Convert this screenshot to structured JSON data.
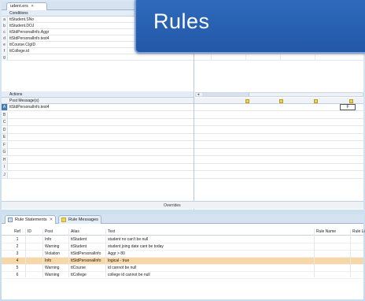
{
  "editor": {
    "tab_label": "udent.ers",
    "tab_close": "✕"
  },
  "conditions": {
    "header": "Conditions",
    "rows": [
      {
        "key": "a",
        "label": "ttStudent.SNo",
        "cells": []
      },
      {
        "key": "b",
        "label": "ttStudent.DOJ",
        "cells": []
      },
      {
        "key": "c",
        "label": "ttStdPersonalInfo.Aggr",
        "cells": []
      },
      {
        "key": "d",
        "label": "ttStdPersonalInfo.test4",
        "cells": [
          "-",
          "-",
          "-",
          "-"
        ]
      },
      {
        "key": "e",
        "label": "ttCourse.CIgID",
        "cells": [
          "-",
          "-",
          "-",
          "-"
        ]
      },
      {
        "key": "f",
        "label": "ttCollege.id",
        "cells": [
          "-",
          "-",
          "-",
          "-"
        ]
      },
      {
        "key": "g",
        "label": "",
        "cells": []
      }
    ]
  },
  "actions": {
    "header": "Actions",
    "subheader": "Post Message(s)",
    "scroll_left": "◂",
    "rows": [
      {
        "key": "A",
        "label": "ttStdPersonalInfo.test4",
        "selected": true
      },
      {
        "key": "B",
        "label": ""
      },
      {
        "key": "C",
        "label": ""
      },
      {
        "key": "D",
        "label": ""
      },
      {
        "key": "E",
        "label": ""
      },
      {
        "key": "F",
        "label": ""
      },
      {
        "key": "G",
        "label": ""
      },
      {
        "key": "H",
        "label": ""
      },
      {
        "key": "I",
        "label": ""
      },
      {
        "key": "J",
        "label": ""
      }
    ],
    "f_cell": "F"
  },
  "overrides_label": "Overrides",
  "banner_title": "Rules",
  "bottom_tabs": [
    {
      "label": "Rule Statements",
      "active": true,
      "close": "✕"
    },
    {
      "label": "Rule Messages",
      "active": false
    }
  ],
  "messages": {
    "columns": {
      "ref": "Ref",
      "id": "ID",
      "post": "Post",
      "alias": "Alias",
      "text": "Text",
      "rule_name": "Rule Name",
      "rule_line": "Rule Lin"
    },
    "rows": [
      {
        "ref": "1",
        "post": "Info",
        "alias": "ttStudent",
        "text": "student no can't be null"
      },
      {
        "ref": "2",
        "post": "Warning",
        "alias": "ttStudent",
        "text": "student joing date cant be today"
      },
      {
        "ref": "3",
        "post": "Violation",
        "alias": "ttStdPersonalInfo",
        "text": "Aggr > 80"
      },
      {
        "ref": "4",
        "post": "Info",
        "alias": "ttStdPersonalInfo",
        "text": "logical - true",
        "highlight": true
      },
      {
        "ref": "5",
        "post": "Warning",
        "alias": "ttCourse",
        "text": "id cannot be null"
      },
      {
        "ref": "6",
        "post": "Warning",
        "alias": "ttCollege",
        "text": "college id cannot be null"
      }
    ]
  },
  "colors": {
    "banner": "#2f6bbd",
    "highlight_row": "#f8d7a6",
    "selected_key": "#4a78b0"
  }
}
